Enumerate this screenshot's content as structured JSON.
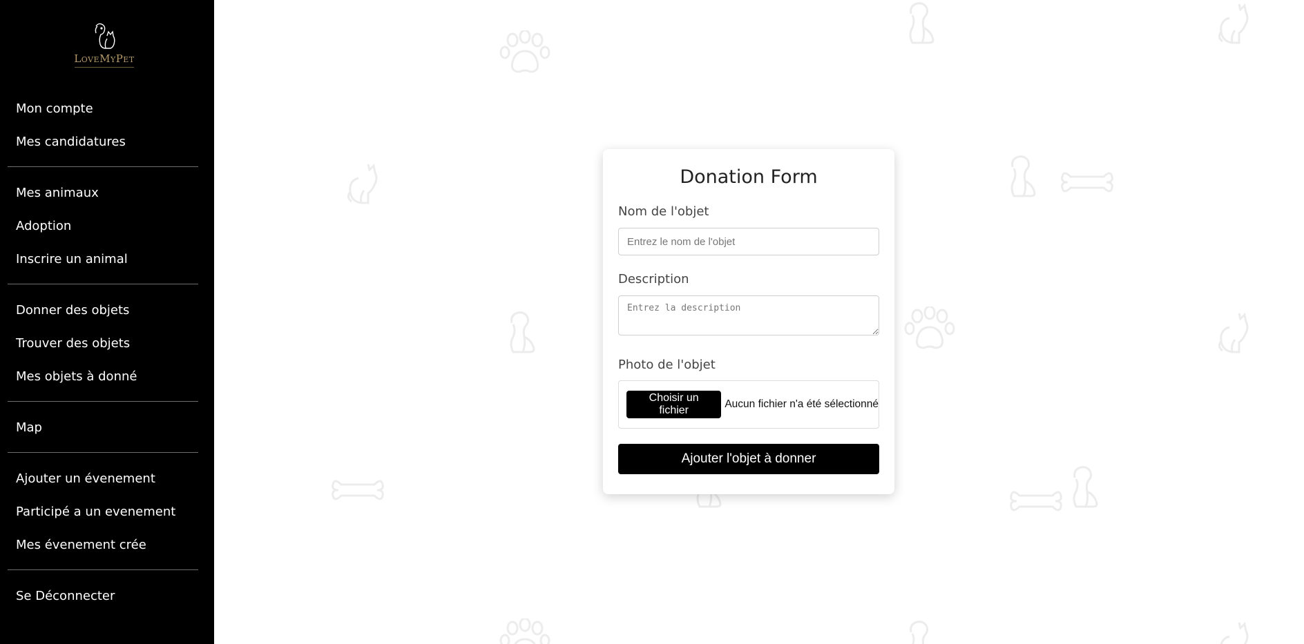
{
  "brand": {
    "name": "LoveMyPet"
  },
  "sidebar": {
    "groups": [
      {
        "items": [
          {
            "label": "Mon compte"
          },
          {
            "label": "Mes candidatures"
          }
        ]
      },
      {
        "items": [
          {
            "label": "Mes animaux"
          },
          {
            "label": "Adoption"
          },
          {
            "label": "Inscrire un animal"
          }
        ]
      },
      {
        "items": [
          {
            "label": "Donner des objets"
          },
          {
            "label": "Trouver des objets"
          },
          {
            "label": "Mes objets à donné"
          }
        ]
      },
      {
        "items": [
          {
            "label": "Map"
          }
        ]
      },
      {
        "items": [
          {
            "label": "Ajouter un évenement"
          },
          {
            "label": "Participé a un evenement"
          },
          {
            "label": "Mes évenement crée"
          }
        ]
      },
      {
        "items": [
          {
            "label": "Se Déconnecter"
          }
        ]
      }
    ]
  },
  "form": {
    "title": "Donation Form",
    "name_label": "Nom de l'objet",
    "name_placeholder": "Entrez le nom de l'objet",
    "description_label": "Description",
    "description_placeholder": "Entrez la description",
    "photo_label": "Photo de l'objet",
    "file_button": "Choisir un fichier",
    "file_status": "Aucun fichier n'a été sélectionné",
    "submit_label": "Ajouter l'objet à donner"
  },
  "background_icons": [
    "paw-icon",
    "cat-icon",
    "dog-icon",
    "bone-icon"
  ],
  "colors": {
    "sidebar_bg": "#000000",
    "accent": "#000000",
    "brand_gold": "#b59a6a",
    "pattern": "#ececec"
  }
}
